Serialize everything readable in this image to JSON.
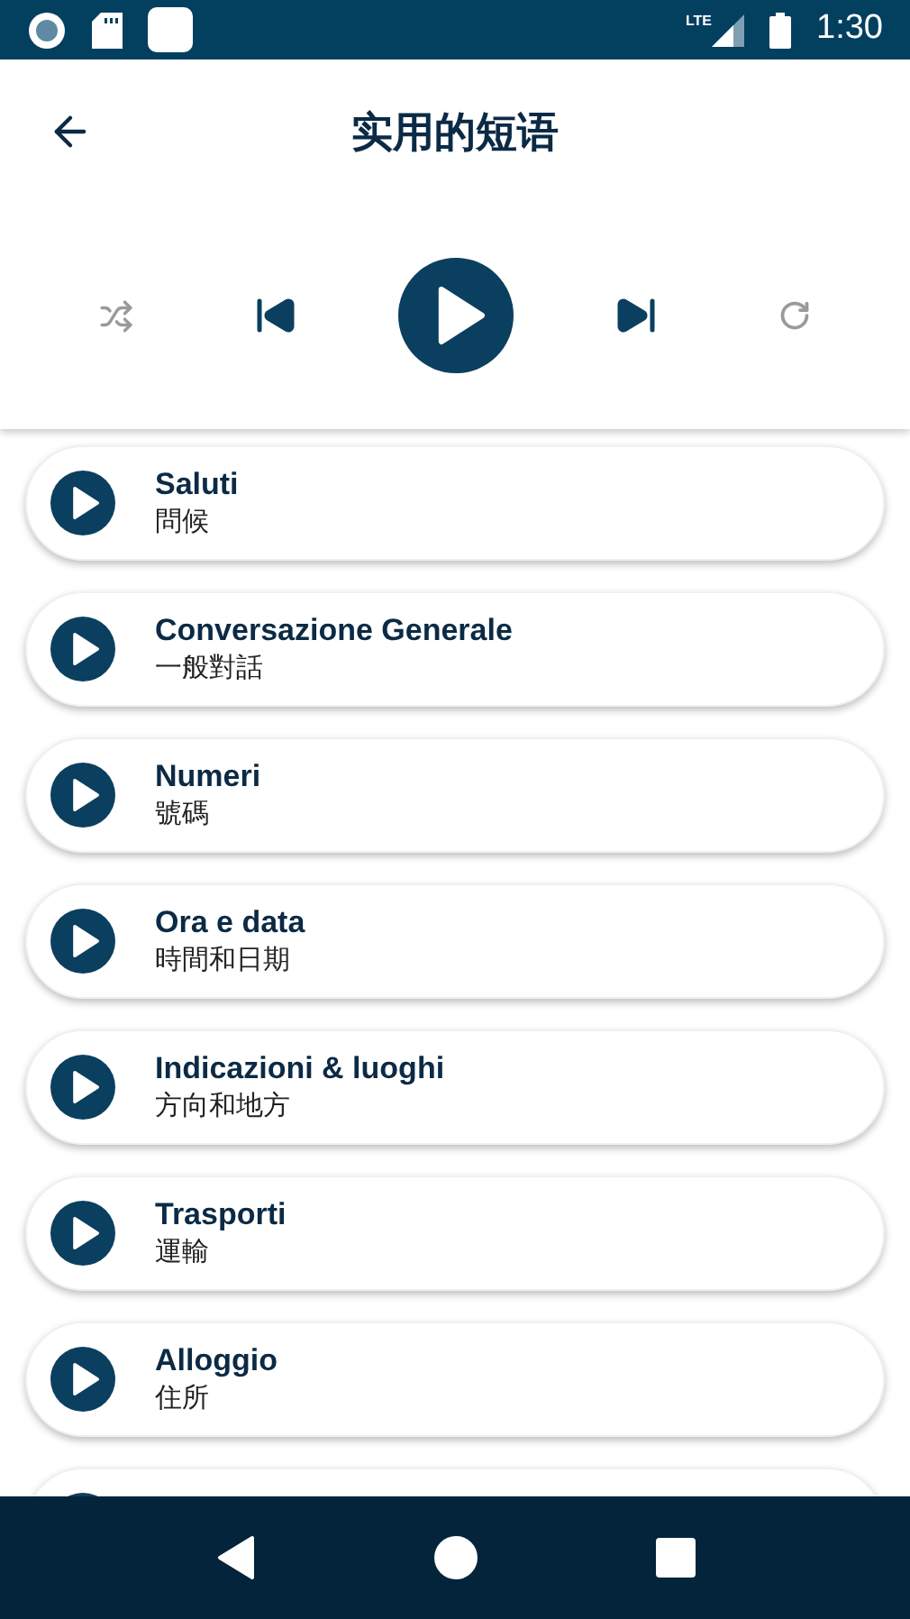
{
  "status_bar": {
    "time": "1:30",
    "network": "LTE"
  },
  "header": {
    "title": "实用的短语"
  },
  "player": {
    "shuffle": {
      "on": false
    },
    "repeat": {
      "on": false
    }
  },
  "phrases": [
    {
      "title": "Saluti",
      "subtitle": "問候"
    },
    {
      "title": "Conversazione Generale",
      "subtitle": "一般對話"
    },
    {
      "title": "Numeri",
      "subtitle": "號碼"
    },
    {
      "title": "Ora e data",
      "subtitle": "時間和日期"
    },
    {
      "title": "Indicazioni & luoghi",
      "subtitle": "方向和地方"
    },
    {
      "title": "Trasporti",
      "subtitle": "運輸"
    },
    {
      "title": "Alloggio",
      "subtitle": "住所"
    }
  ]
}
